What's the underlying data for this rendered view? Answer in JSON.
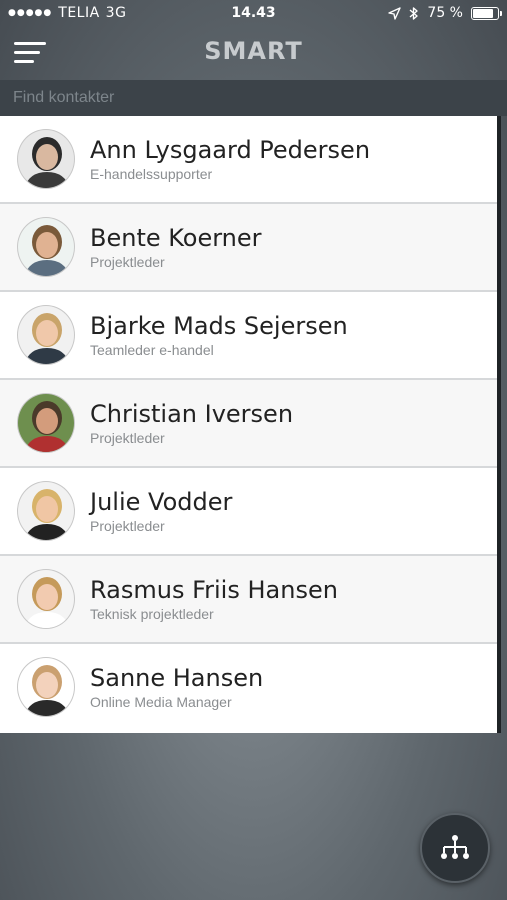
{
  "status_bar": {
    "carrier": "TELIA",
    "network": "3G",
    "time": "14.43",
    "battery_percent": "75 %",
    "battery_level": 0.75
  },
  "header": {
    "title": "SMART",
    "menu_icon": "hamburger-menu-icon"
  },
  "search": {
    "placeholder": "Find kontakter",
    "value": ""
  },
  "contacts": [
    {
      "name": "Ann Lysgaard Pedersen",
      "role": "E-handelssupporter"
    },
    {
      "name": "Bente Koerner",
      "role": "Projektleder"
    },
    {
      "name": "Bjarke Mads Sejersen",
      "role": "Teamleder e-handel"
    },
    {
      "name": "Christian Iversen",
      "role": "Projektleder"
    },
    {
      "name": "Julie Vodder",
      "role": "Projektleder"
    },
    {
      "name": "Rasmus Friis Hansen",
      "role": "Teknisk projektleder"
    },
    {
      "name": "Sanne Hansen",
      "role": "Online Media Manager"
    }
  ],
  "fab": {
    "icon": "org-chart-icon"
  },
  "colors": {
    "background": "#5f676d",
    "search_bar": "#3c4349",
    "list_background": "#ffffff",
    "fab": "#2c3237"
  }
}
